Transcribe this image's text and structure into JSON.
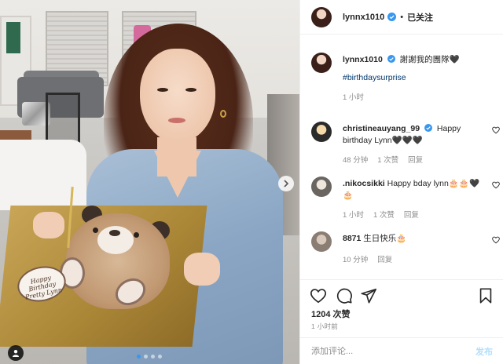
{
  "post": {
    "username": "lynnx1010",
    "follow_status": "已关注",
    "separator": "•",
    "photo": {
      "plaque_line1": "Happy Birthday",
      "plaque_line2": "Pretty Lynn",
      "carousel_total": 4,
      "carousel_active": 1
    }
  },
  "caption": {
    "username": "lynnx1010",
    "text": "謝謝我的團隊🖤",
    "hashtag": "#birthdaysurprise",
    "time": "1 小时"
  },
  "comments": [
    {
      "username": "christineauyang_99",
      "text": "Happy birthday Lynn🖤🖤🖤",
      "time": "48 分钟",
      "likes": "1 次赞",
      "reply": "回复",
      "verified": true
    },
    {
      "username": ".nikocsikki",
      "text": "Happy bday lynn🎂🎂🖤🎂",
      "time": "1 小时",
      "likes": "1 次赞",
      "reply": "回复",
      "verified": false
    },
    {
      "username": "8871",
      "text": "生日快乐🎂",
      "time": "10 分钟",
      "likes": "",
      "reply": "回复",
      "verified": false
    }
  ],
  "stats": {
    "likes": "1204 次赞",
    "time": "1 小时前"
  },
  "comment_box": {
    "placeholder": "添加评论...",
    "post_label": "发布"
  },
  "colors": {
    "verified": "#3897f0",
    "link": "#00376b",
    "muted": "#8e8e8e",
    "post_disabled": "#b2dffc"
  }
}
